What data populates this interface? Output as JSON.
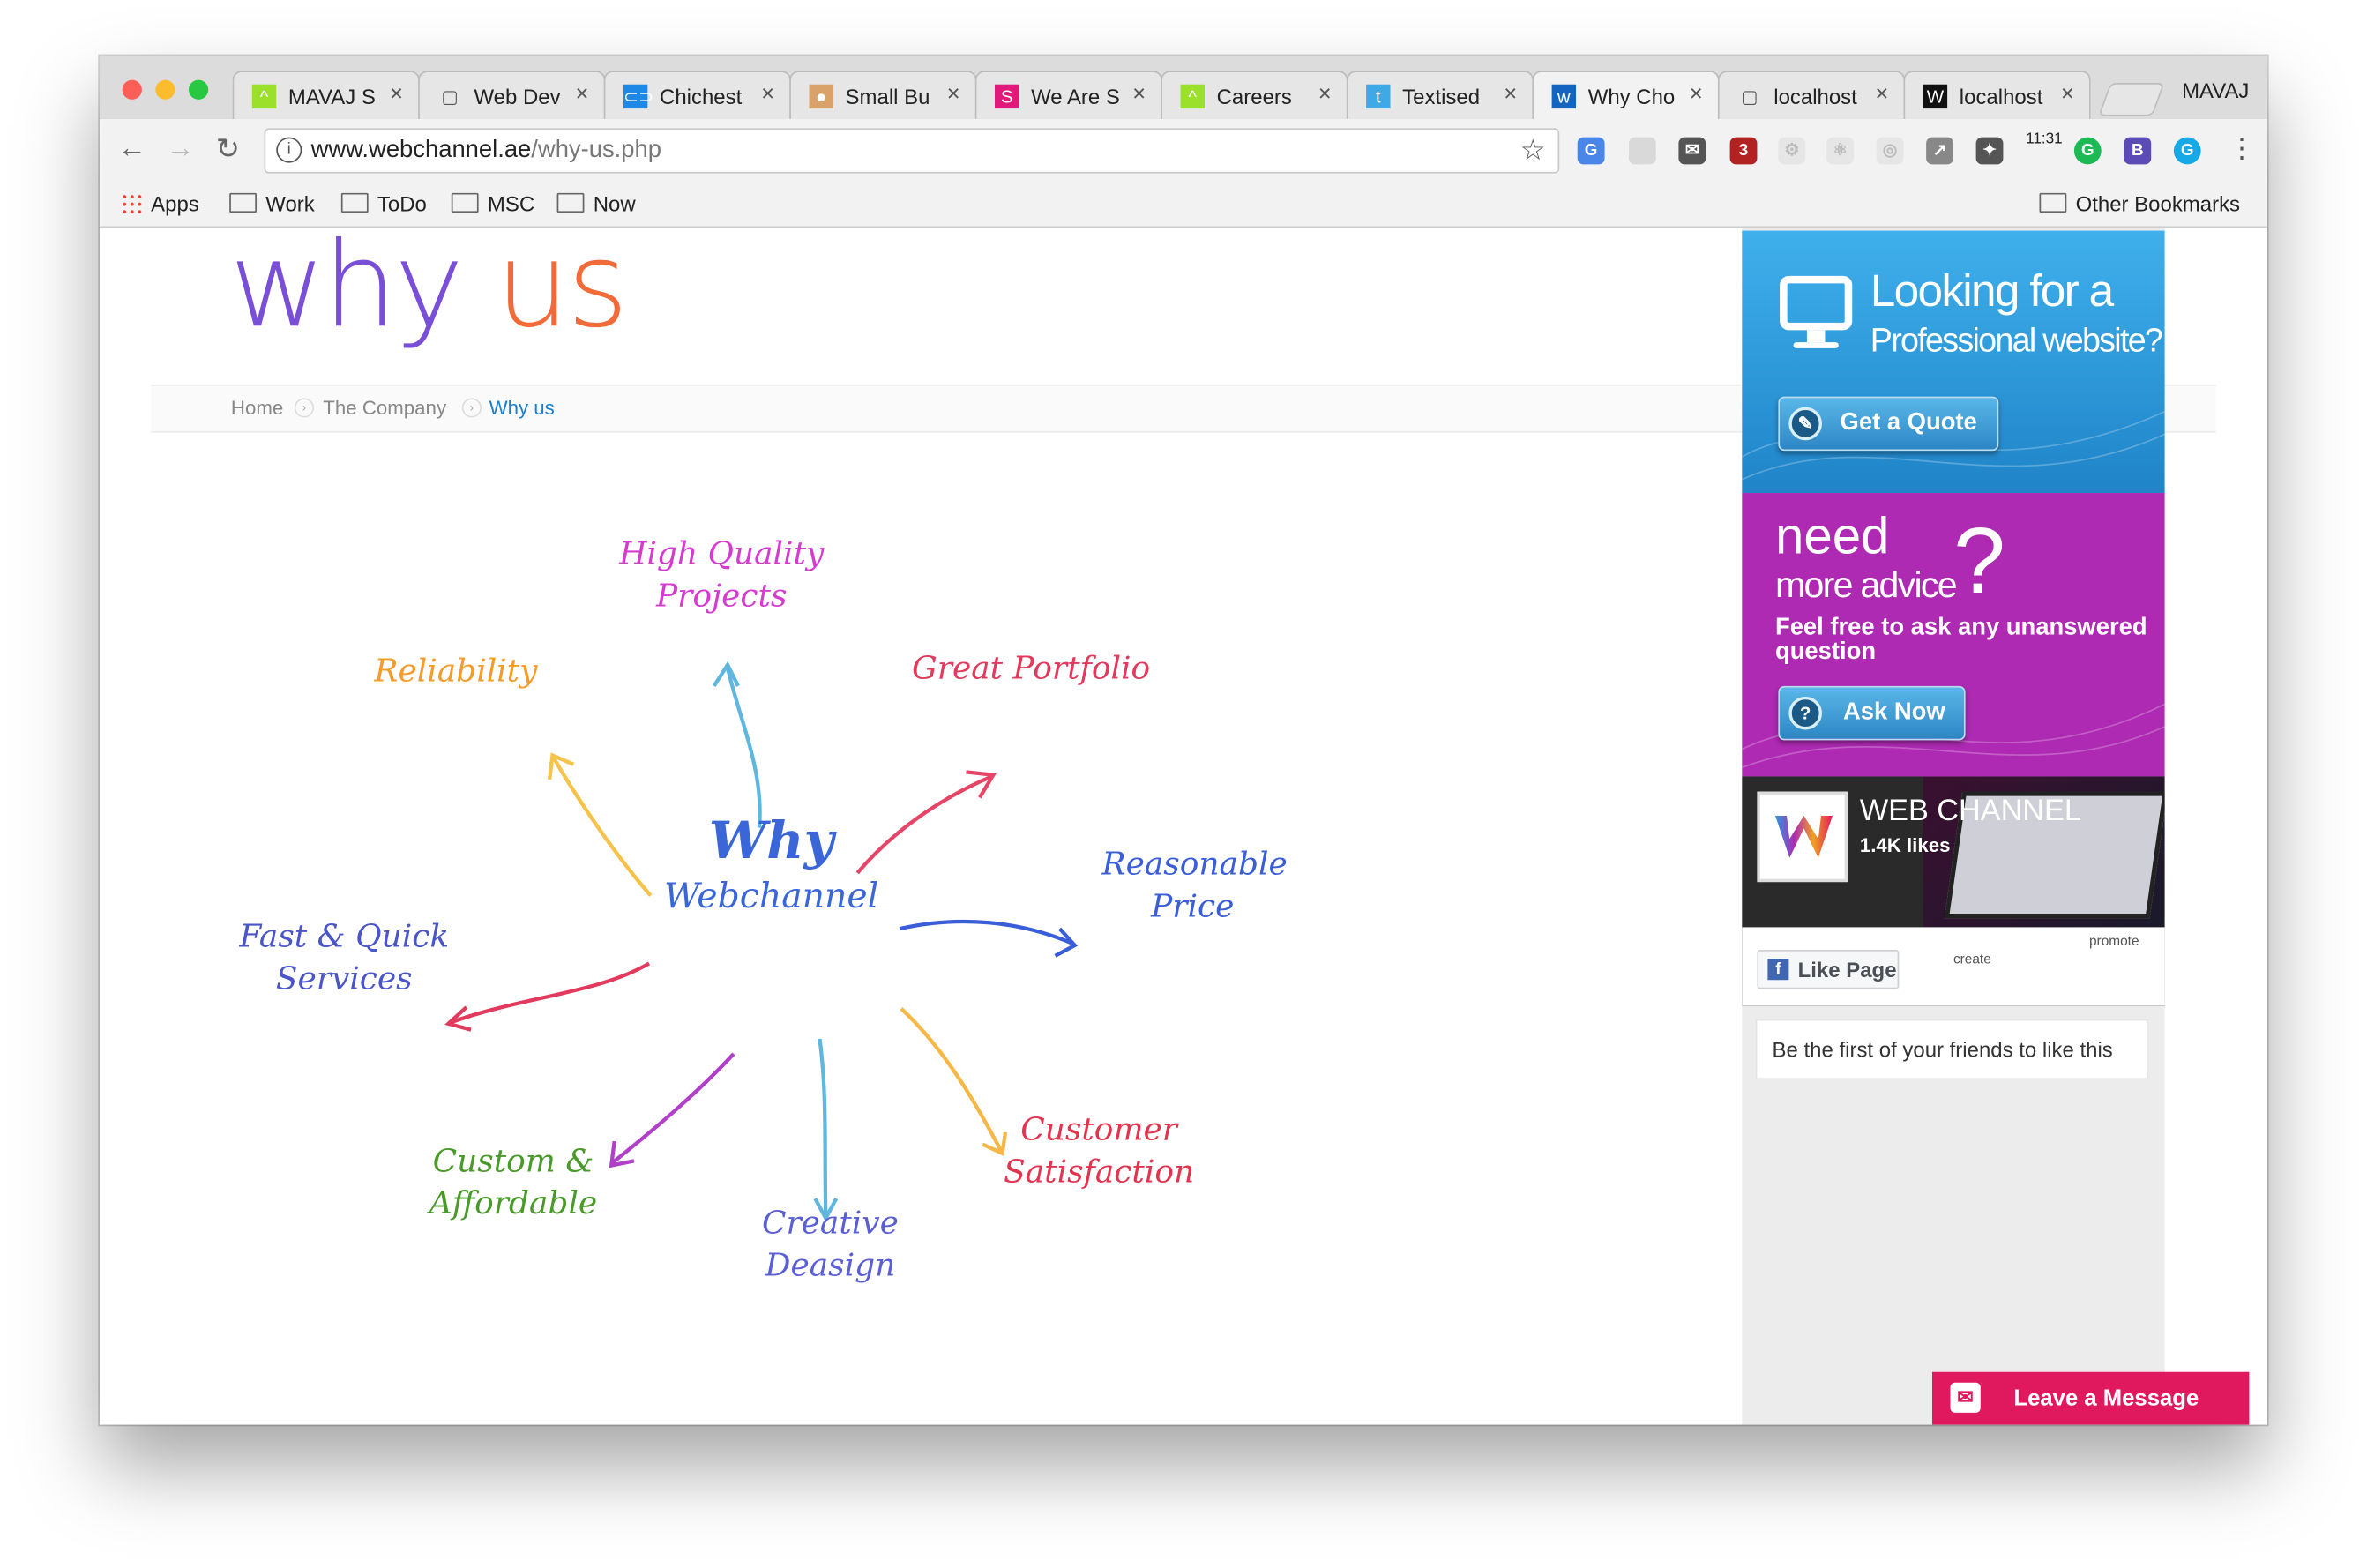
{
  "browser": {
    "tabs": [
      {
        "title": "MAVAJ S",
        "icon": "caret-logo-icon",
        "active": false
      },
      {
        "title": "Web Dev",
        "icon": "document-icon",
        "active": false
      },
      {
        "title": "Chichest",
        "icon": "cd-logo-icon",
        "active": false
      },
      {
        "title": "Small Bu",
        "icon": "mustache-avatar-icon",
        "active": false
      },
      {
        "title": "We Are S",
        "icon": "diamond-s-icon",
        "active": false
      },
      {
        "title": "Careers",
        "icon": "caret-logo-icon",
        "active": false
      },
      {
        "title": "Textised",
        "icon": "t-logo-icon",
        "active": false
      },
      {
        "title": "Why Cho",
        "icon": "w-logo-icon",
        "active": true
      },
      {
        "title": "localhost",
        "icon": "document-icon",
        "active": false
      },
      {
        "title": "localhost",
        "icon": "ws-logo-icon",
        "active": false
      }
    ],
    "close_glyph": "×",
    "profile_name": "MAVAJ",
    "url": {
      "host": "www.webchannel.ae",
      "path": "/why-us.php"
    },
    "extension_clock": "11:31",
    "extension_b": "B",
    "extension_g": "G",
    "bookmarks": {
      "apps": "Apps",
      "items": [
        "Work",
        "ToDo",
        "MSC",
        "Now"
      ],
      "other": "Other Bookmarks"
    }
  },
  "page": {
    "heading_word1": "why",
    "heading_word2": "us",
    "breadcrumb": [
      "Home",
      "The Company",
      "Why us"
    ],
    "mindmap": {
      "center_line1": "Why",
      "center_line2": "Webchannel",
      "items": [
        {
          "text": "High Quality Projects",
          "color": "#d63bd0"
        },
        {
          "text": "Great Portfolio",
          "color": "#e23a5c"
        },
        {
          "text": "Reasonable Price",
          "color": "#3a5ed8"
        },
        {
          "text": "Customer Satisfaction",
          "color": "#e3344f"
        },
        {
          "text": "Creative Deasign",
          "color": "#5a5fd3"
        },
        {
          "text": "Custom & Affordable",
          "color": "#4a9a2a"
        },
        {
          "text": "Fast & Quick Services",
          "color": "#4a55c8"
        },
        {
          "text": "Reliability",
          "color": "#f39c2a"
        }
      ]
    }
  },
  "sidebar": {
    "quote": {
      "line1": "Looking for a",
      "line2": "Professional website?",
      "button": "Get a Quote"
    },
    "advice": {
      "need": "need",
      "more": "more advice",
      "qmark": "?",
      "text": "Feel free to ask any unanswered question",
      "button": "Ask Now"
    },
    "facebook": {
      "name": "WEB CHANNEL",
      "likes": "1.4K likes",
      "like_button": "Like Page",
      "friends": "Be the first of your friends to like this",
      "col_create": "create",
      "col_promote": "promote"
    }
  },
  "chat": {
    "label": "Leave a Message"
  },
  "colors": {
    "brand_blue": "#2a9be0",
    "brand_purple": "#ae2ab3",
    "leave_pink": "#e0195f",
    "link_blue": "#1a7fd0"
  }
}
